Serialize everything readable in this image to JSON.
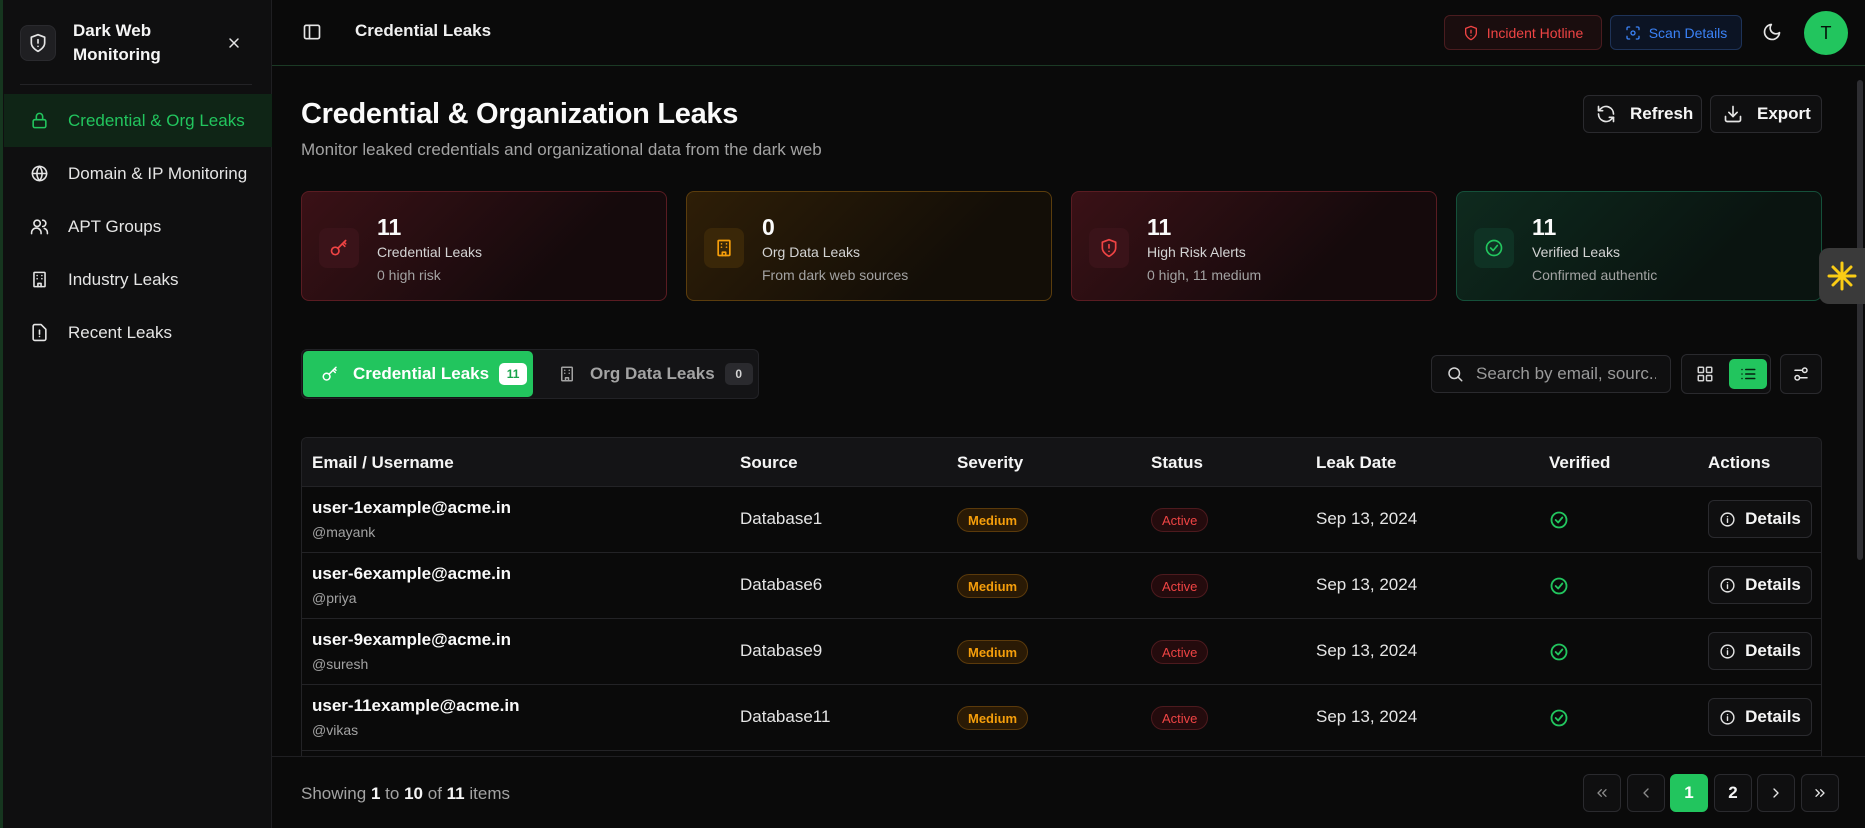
{
  "sidebar": {
    "brand": "Dark Web Monitoring",
    "items": [
      {
        "label": "Credential & Org Leaks",
        "icon": "lock-icon",
        "active": true
      },
      {
        "label": "Domain & IP Monitoring",
        "icon": "globe-icon"
      },
      {
        "label": "APT Groups",
        "icon": "users-icon"
      },
      {
        "label": "Industry Leaks",
        "icon": "building-icon"
      },
      {
        "label": "Recent Leaks",
        "icon": "file-alert-icon"
      }
    ]
  },
  "header": {
    "breadcrumb": "Credential Leaks",
    "incident_hotline": "Incident Hotline",
    "scan_details": "Scan Details",
    "avatar_initial": "T"
  },
  "main": {
    "title": "Credential & Organization Leaks",
    "subtitle": "Monitor leaked credentials and organizational data from the dark web",
    "refresh_label": "Refresh",
    "export_label": "Export"
  },
  "stats": [
    {
      "value": "11",
      "label": "Credential Leaks",
      "sub": "0 high risk",
      "icon": "key-icon",
      "color": "#ef4444"
    },
    {
      "value": "0",
      "label": "Org Data Leaks",
      "sub": "From dark web sources",
      "icon": "building-icon",
      "color": "#f59e0b"
    },
    {
      "value": "11",
      "label": "High Risk Alerts",
      "sub": "0 high, 11 medium",
      "icon": "shield-alert-icon",
      "color": "#ef4444"
    },
    {
      "value": "11",
      "label": "Verified Leaks",
      "sub": "Confirmed authentic",
      "icon": "check-circle-icon",
      "color": "#22c55e"
    }
  ],
  "tabs": [
    {
      "label": "Credential Leaks",
      "count": "11",
      "active": true
    },
    {
      "label": "Org Data Leaks",
      "count": "0",
      "active": false
    }
  ],
  "search": {
    "placeholder": "Search by email, sourc..."
  },
  "table": {
    "columns": [
      "Email / Username",
      "Source",
      "Severity",
      "Status",
      "Leak Date",
      "Verified",
      "Actions"
    ],
    "rows": [
      {
        "email": "user-1example@acme.in",
        "username": "@mayank",
        "source": "Database1",
        "severity": "Medium",
        "status": "Active",
        "date": "Sep 13, 2024",
        "verified": true,
        "action": "Details"
      },
      {
        "email": "user-6example@acme.in",
        "username": "@priya",
        "source": "Database6",
        "severity": "Medium",
        "status": "Active",
        "date": "Sep 13, 2024",
        "verified": true,
        "action": "Details"
      },
      {
        "email": "user-9example@acme.in",
        "username": "@suresh",
        "source": "Database9",
        "severity": "Medium",
        "status": "Active",
        "date": "Sep 13, 2024",
        "verified": true,
        "action": "Details"
      },
      {
        "email": "user-11example@acme.in",
        "username": "@vikas",
        "source": "Database11",
        "severity": "Medium",
        "status": "Active",
        "date": "Sep 13, 2024",
        "verified": true,
        "action": "Details"
      }
    ]
  },
  "pagination": {
    "showing_prefix": "Showing",
    "from": "1",
    "to_word": "to",
    "to": "10",
    "of_word": "of",
    "total": "11",
    "items_word": "items",
    "pages": [
      "1",
      "2"
    ],
    "current": "1"
  },
  "colors": {
    "accent": "#22c55e",
    "danger": "#ef4444",
    "warning": "#f59e0b",
    "info": "#3b82f6"
  }
}
